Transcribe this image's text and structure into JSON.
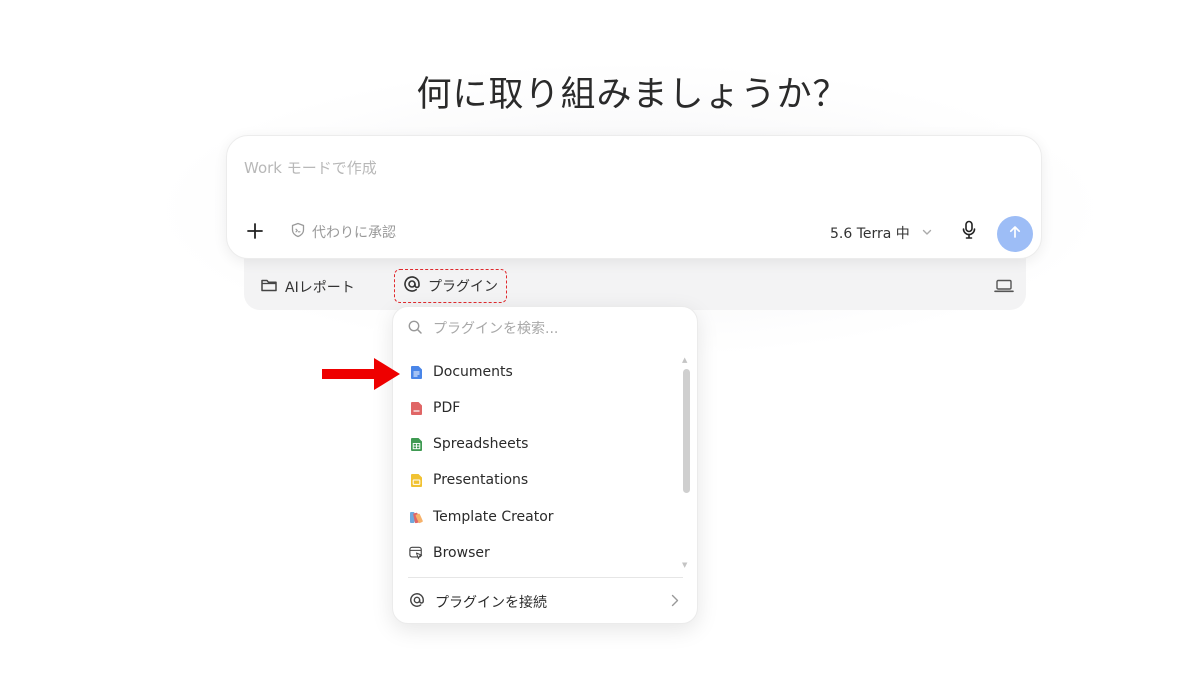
{
  "heading": "何に取り組みましょうか？",
  "composer": {
    "placeholder": "Work モードで作成",
    "approve_label": "代わりに承認",
    "model_label": "5.6 Terra 中"
  },
  "toolbar": {
    "report_label": "AIレポート",
    "plugin_label": "プラグイン"
  },
  "plugin_menu": {
    "search_placeholder": "プラグインを検索...",
    "items": [
      {
        "label": "Documents",
        "icon": "documents-icon",
        "color": "#4a86e8"
      },
      {
        "label": "PDF",
        "icon": "pdf-icon",
        "color": "#e06666"
      },
      {
        "label": "Spreadsheets",
        "icon": "spreadsheets-icon",
        "color": "#3f9a52"
      },
      {
        "label": "Presentations",
        "icon": "presentations-icon",
        "color": "#f1c232"
      },
      {
        "label": "Template Creator",
        "icon": "template-creator-icon",
        "color": "#8e7cc3"
      },
      {
        "label": "Browser",
        "icon": "browser-icon",
        "color": "#444444"
      }
    ],
    "connect_label": "プラグインを接続"
  },
  "colors": {
    "send_button": "#9dbdf6",
    "highlight_border": "#e1292d",
    "annotation_arrow": "#ee0000"
  }
}
